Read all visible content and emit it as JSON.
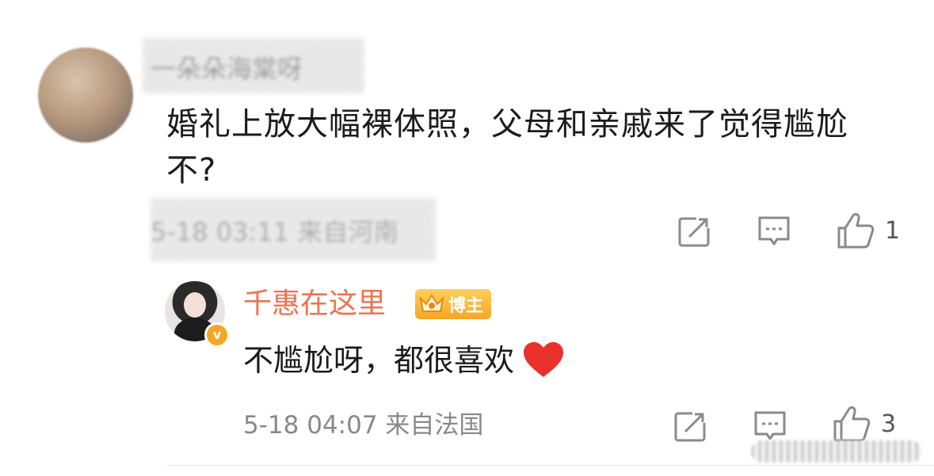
{
  "comment": {
    "author": "一朵朵海棠呀",
    "text": "婚礼上放大幅裸体照，父母和亲戚来了觉得尴尬不?",
    "meta": "5-18 03:11 来自河南",
    "like_count": "1"
  },
  "reply": {
    "author": "千惠在这里",
    "host_badge": "博主",
    "verified_mark": "v",
    "text": "不尴尬呀，都很喜欢",
    "meta": "5-18 04:07 来自法国",
    "like_count": "3"
  },
  "colors": {
    "author_orange": "#eb7350",
    "badge_gold": "#f5a623",
    "icon_gray": "#8a8a8a",
    "heart_red": "#e8312c"
  },
  "icons": [
    "share-icon",
    "comment-icon",
    "like-icon",
    "heart-icon",
    "crown-icon"
  ]
}
